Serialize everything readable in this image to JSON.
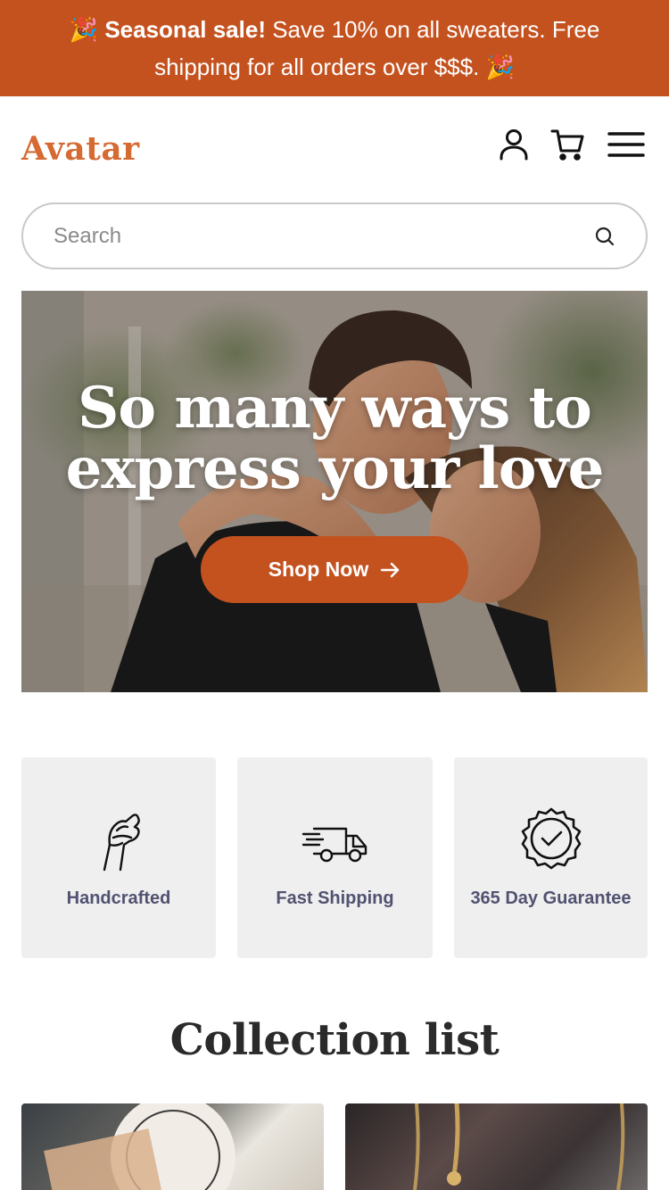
{
  "announcement": {
    "emoji": "🎉",
    "bold": "Seasonal sale!",
    "text": " Save 10% on all sweaters. Free shipping for all orders over $$$. ",
    "emoji_end": "🎉",
    "background": "#c4521f"
  },
  "header": {
    "logo": "Avatar",
    "logo_color": "#d56a33",
    "icons": [
      "account-icon",
      "cart-icon",
      "menu-icon"
    ]
  },
  "search": {
    "placeholder": "Search",
    "icon": "search-icon"
  },
  "hero": {
    "title": "So many ways to express your love",
    "button_label": "Shop Now",
    "button_icon": "arrow-right-icon",
    "button_color": "#c4521f"
  },
  "features": [
    {
      "label": "Handcrafted",
      "icon": "hand-icon"
    },
    {
      "label": "Fast Shipping",
      "icon": "truck-icon"
    },
    {
      "label": "365 Day Guarantee",
      "icon": "badge-check-icon"
    }
  ],
  "collection": {
    "title": "Collection list"
  }
}
